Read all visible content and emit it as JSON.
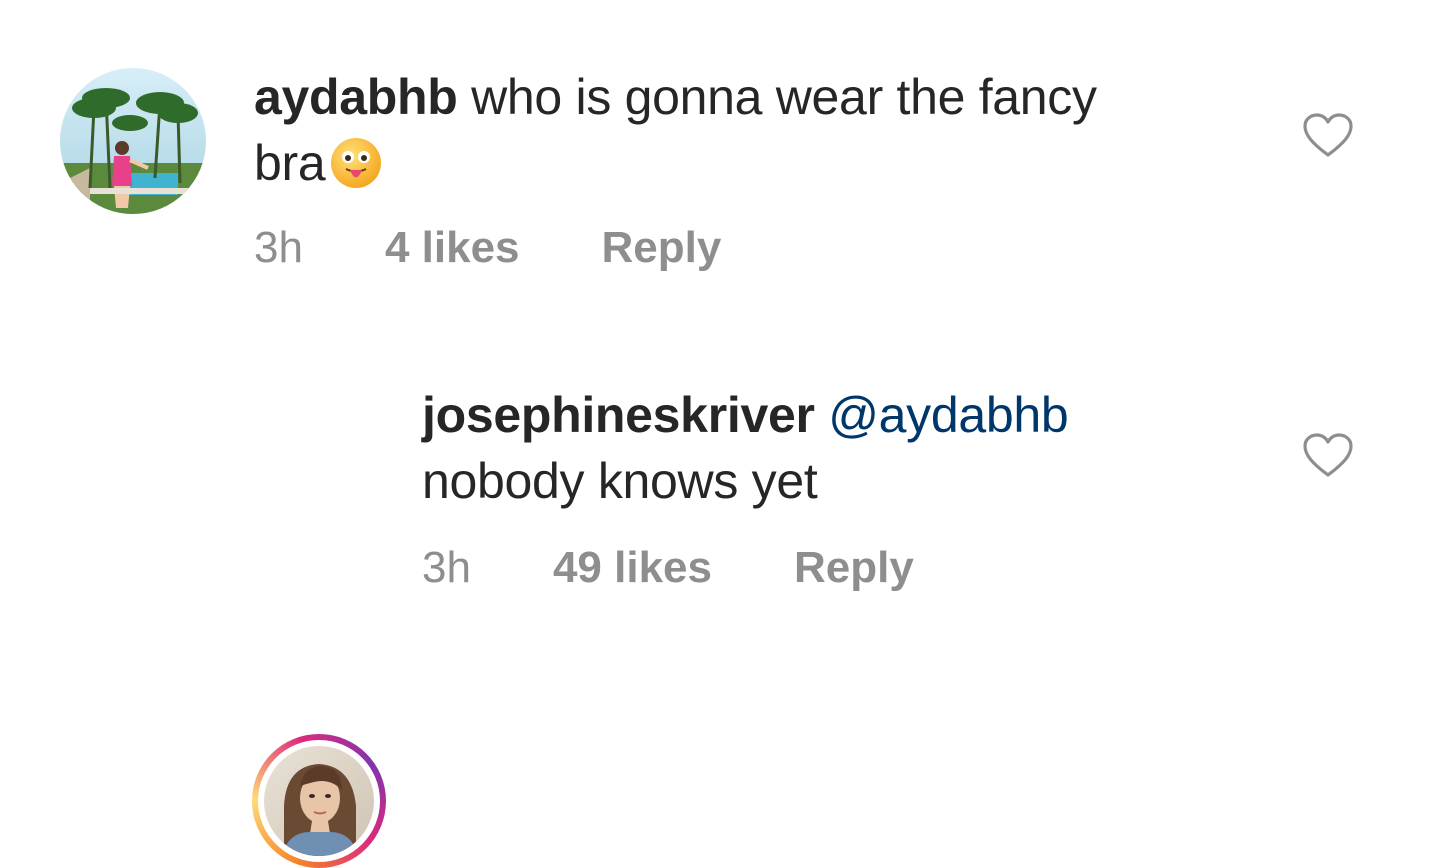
{
  "comments": [
    {
      "username": "aydabhb",
      "text_line1": "who is gonna wear the fancy",
      "text_line2": "bra",
      "emoji": "stuck-out-tongue-face",
      "time": "3h",
      "likes": "4 likes",
      "reply_label": "Reply",
      "avatar": "beach-resort-photo"
    },
    {
      "username": "josephineskriver",
      "mention": "@aydabhb",
      "text": "nobody knows yet",
      "time": "3h",
      "likes": "49 likes",
      "reply_label": "Reply",
      "avatar": "portrait-photo",
      "has_story_ring": true
    }
  ],
  "colors": {
    "username": "#262626",
    "mention": "#00376b",
    "meta": "#8e8e8e",
    "heart_outline": "#8e8e8e"
  },
  "icons": {
    "like": "heart-outline-icon"
  }
}
